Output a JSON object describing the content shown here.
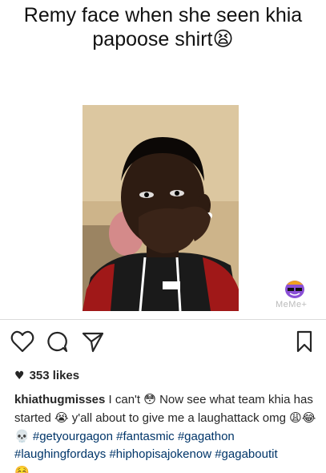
{
  "meme": {
    "caption_line1": "Remy face when she seen khia",
    "caption_line2": "papoose shirt",
    "caption_emoji": "😫"
  },
  "watermark": {
    "text": "MeMe+"
  },
  "actions": {
    "like_icon": "heart-outline-icon",
    "comment_icon": "comment-bubble-icon",
    "share_icon": "send-paper-plane-icon",
    "save_icon": "bookmark-icon"
  },
  "post": {
    "likes": "353 likes",
    "username": "khiathugmisses",
    "text1": " I can't ",
    "emoji1": "😳",
    "text2": " Now see what team khia has started ",
    "emoji2": "😭",
    "text3": "  y'all about to give me a laughattack omg ",
    "emoji3": "😩😂💀",
    "hashtags": [
      "#getyourgagon",
      "#fantasmic",
      "#gagathon",
      "#laughingfordays",
      "#hiphopisajokenow",
      "#gagaboutit"
    ],
    "emoji4": "☺️"
  }
}
